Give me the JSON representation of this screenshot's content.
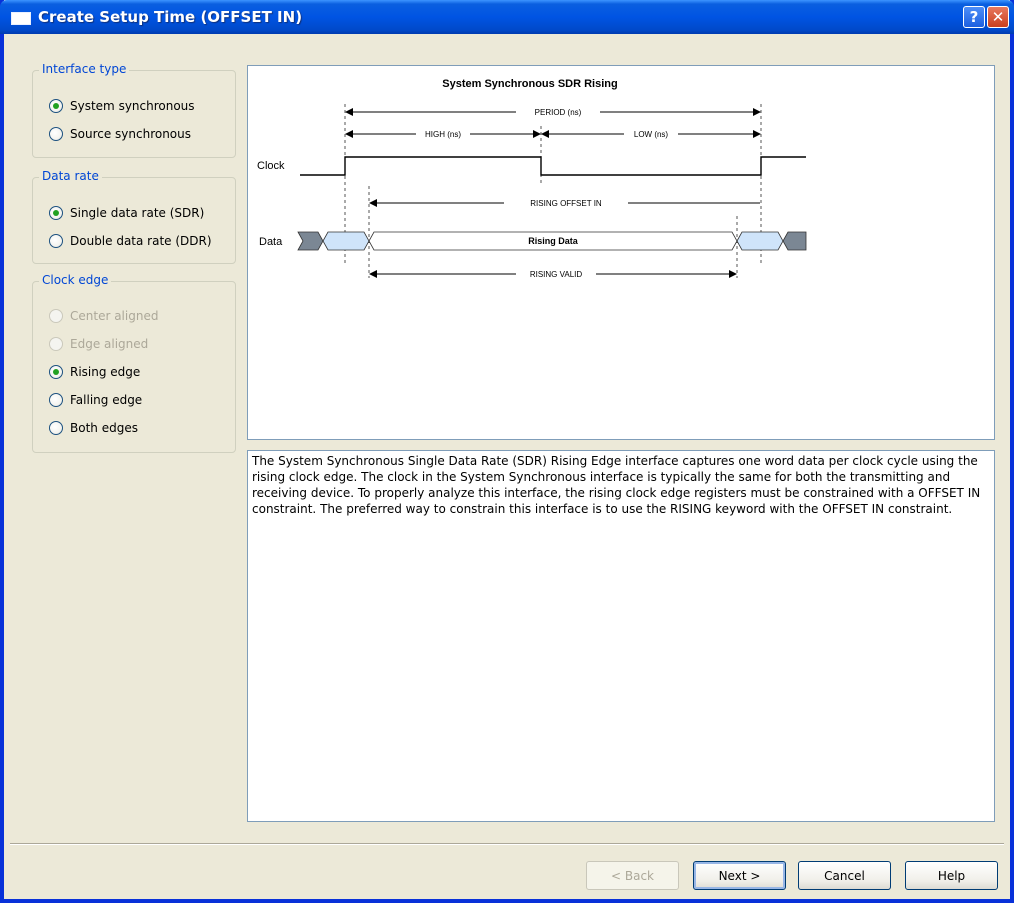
{
  "window": {
    "title": "Create Setup Time (OFFSET IN)",
    "help_glyph": "?",
    "close_glyph": "✕"
  },
  "left": {
    "interface_type": {
      "label": "Interface type",
      "options": [
        {
          "label": "System synchronous",
          "checked": true
        },
        {
          "label": "Source synchronous",
          "checked": false
        }
      ]
    },
    "data_rate": {
      "label": "Data rate",
      "options": [
        {
          "label": "Single data rate (SDR)",
          "checked": true
        },
        {
          "label": "Double data rate (DDR)",
          "checked": false
        }
      ]
    },
    "clock_edge": {
      "label": "Clock edge",
      "options": [
        {
          "label": "Center aligned",
          "checked": false,
          "disabled": true
        },
        {
          "label": "Edge aligned",
          "checked": false,
          "disabled": true
        },
        {
          "label": "Rising edge",
          "checked": true
        },
        {
          "label": "Falling edge",
          "checked": false
        },
        {
          "label": "Both edges",
          "checked": false
        }
      ]
    }
  },
  "diagram": {
    "title": "System Synchronous SDR Rising",
    "clock_label": "Clock",
    "data_label": "Data",
    "period": "PERIOD (ns)",
    "high": "HIGH (ns)",
    "low": "LOW (ns)",
    "offset_in": "RISING OFFSET IN",
    "data_text": "Rising Data",
    "valid": "RISING VALID",
    "colors": {
      "transition": "#7b8794",
      "uncertain": "#cfe4fa"
    }
  },
  "description": "The System Synchronous Single Data Rate (SDR) Rising Edge interface captures one word data per clock cycle using the rising clock edge. The clock in the System Synchronous interface is typically the same for both the transmitting and receiving device. To properly analyze this interface, the rising clock edge registers must be constrained with a OFFSET IN constraint. The preferred way to constrain this interface is to use the RISING keyword with the OFFSET IN constraint.",
  "buttons": {
    "back": "< Back",
    "next": "Next >",
    "cancel": "Cancel",
    "help": "Help"
  }
}
